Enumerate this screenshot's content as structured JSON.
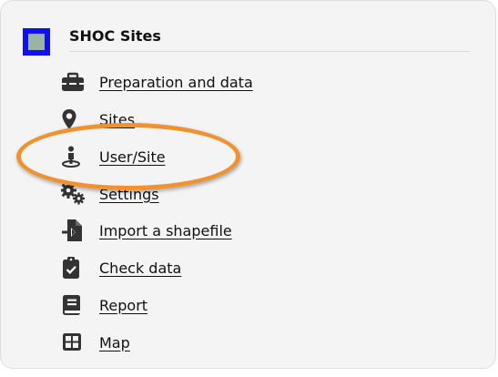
{
  "panel": {
    "title": "SHOC Sites",
    "logo_colors": {
      "border": "#1010ee",
      "fill": "#9ab3a6"
    }
  },
  "menu": {
    "items": [
      {
        "label": "Preparation and data",
        "icon": "toolbox-icon"
      },
      {
        "label": "Sites",
        "icon": "map-marker-icon"
      },
      {
        "label": "User/Site",
        "icon": "person-pin-icon"
      },
      {
        "label": "Settings",
        "icon": "gears-icon"
      },
      {
        "label": "Import a shapefile",
        "icon": "file-import-icon"
      },
      {
        "label": "Check data",
        "icon": "clipboard-check-icon"
      },
      {
        "label": "Report",
        "icon": "book-icon"
      },
      {
        "label": "Map",
        "icon": "grid-table-icon"
      }
    ]
  },
  "annotation": {
    "highlighted_item": "User/Site",
    "color": "#f0922f"
  }
}
